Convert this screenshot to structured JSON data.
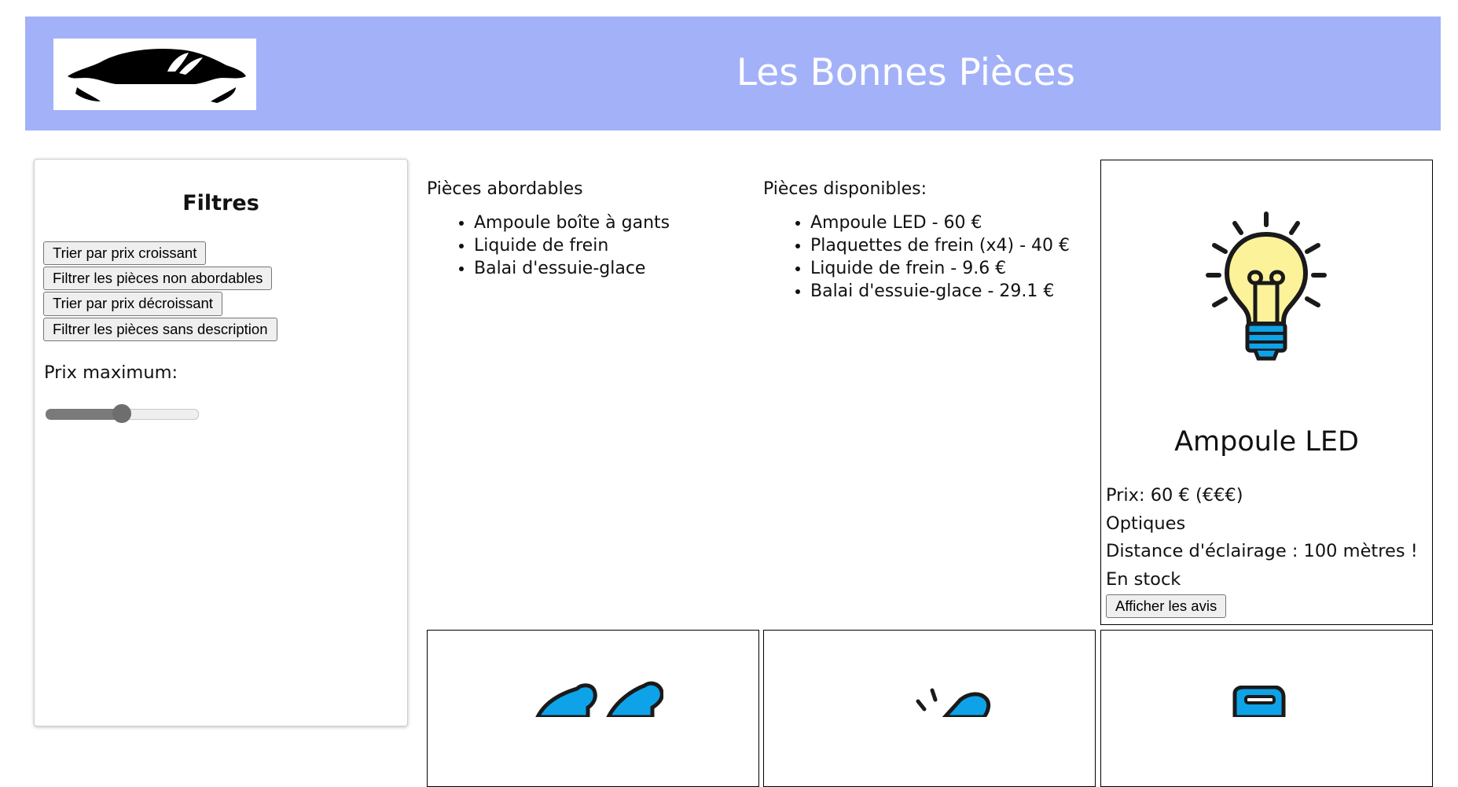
{
  "header": {
    "title": "Les Bonnes Pièces"
  },
  "filters": {
    "title": "Filtres",
    "buttons": [
      "Trier par prix croissant",
      "Filtrer les pièces non abordables",
      "Trier par prix décroissant",
      "Filtrer les pièces sans description"
    ],
    "max_price_label": "Prix maximum:",
    "max_price_slider_fraction": 0.5
  },
  "affordable": {
    "heading": "Pièces abordables",
    "items": [
      "Ampoule boîte à gants",
      "Liquide de frein",
      "Balai d'essuie-glace"
    ]
  },
  "available": {
    "heading": "Pièces disponibles:",
    "items": [
      "Ampoule LED - 60 €",
      "Plaquettes de frein (x4) - 40 €",
      "Liquide de frein - 9.6 €",
      "Balai d'essuie-glace - 29.1 €"
    ]
  },
  "featured_card": {
    "name": "Ampoule LED",
    "price": "Prix: 60 € (€€€)",
    "category": "Optiques",
    "description": "Distance d'éclairage : 100 mètres !",
    "stock": "En stock",
    "reviews_button": "Afficher les avis",
    "icon": "light-bulb-icon"
  },
  "colors": {
    "header_bg": "#a3b1f9",
    "bulb_yellow": "#fbf29a",
    "bulb_base": "#0ea3e8"
  }
}
